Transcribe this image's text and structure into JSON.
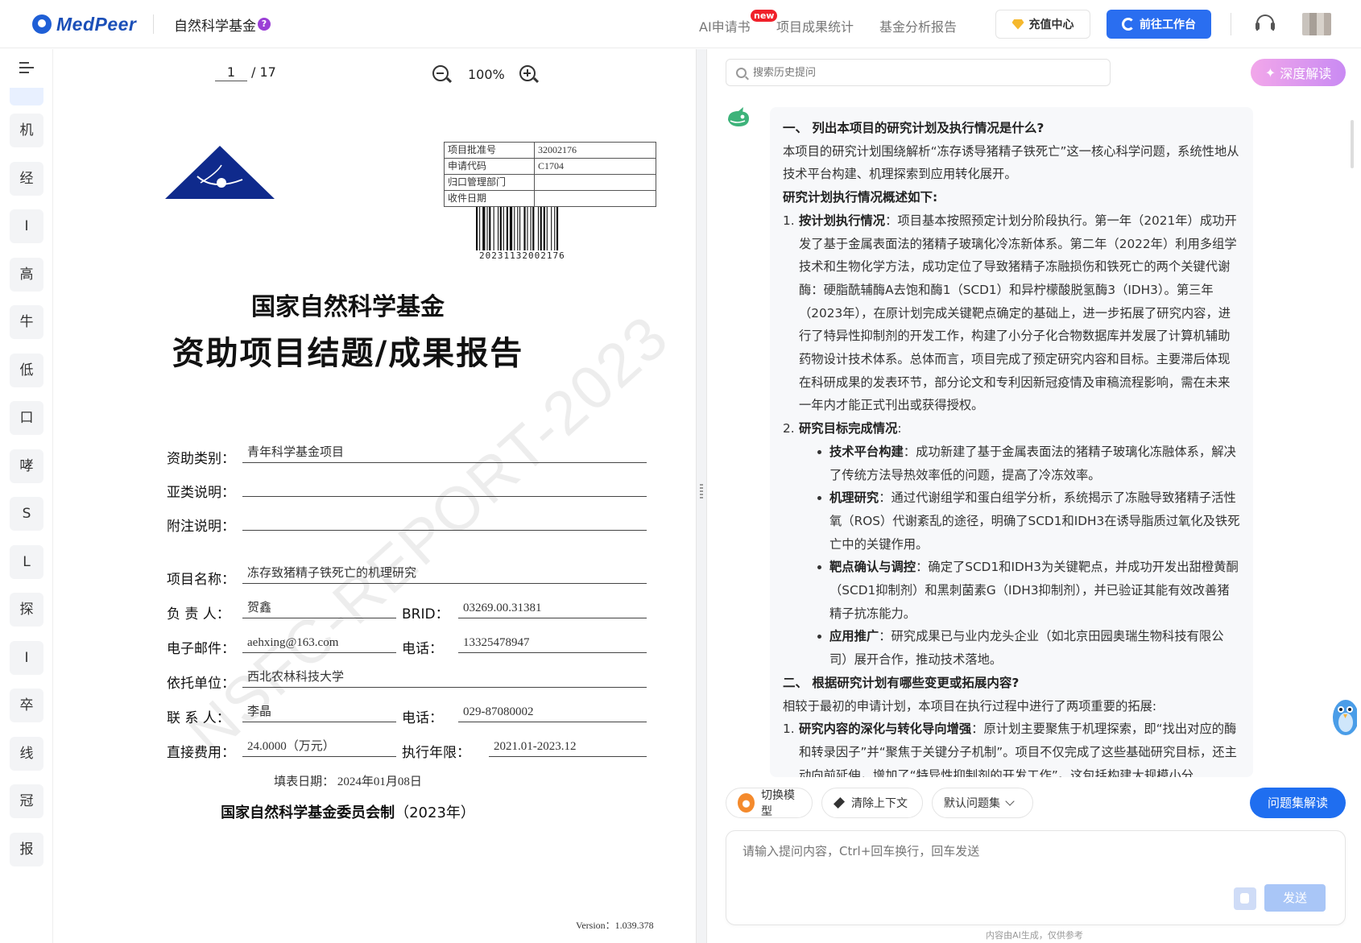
{
  "header": {
    "logo_text": "MedPeer",
    "app_name": "自然科学基金",
    "help_badge": "?",
    "nav": {
      "ai_application": "AI申请书",
      "new_badge": "new",
      "results_stats": "项目成果统计",
      "fund_report": "基金分析报告"
    },
    "recharge_label": "充值中心",
    "workbench_label": "前往工作台"
  },
  "rail": {
    "items": [
      "机",
      "经",
      "I",
      "高",
      "牛",
      "低",
      "口",
      "哮",
      "S",
      "L",
      "探",
      "I",
      "卒",
      "线",
      "冠",
      "报"
    ]
  },
  "viewer": {
    "page": "1",
    "page_total": "/ 17",
    "zoom": "100%"
  },
  "document": {
    "meta": [
      {
        "label": "项目批准号",
        "value": "32002176"
      },
      {
        "label": "申请代码",
        "value": "C1704"
      },
      {
        "label": "归口管理部门",
        "value": ""
      },
      {
        "label": "收件日期",
        "value": ""
      }
    ],
    "barcode_number": "20231132002176",
    "title1": "国家自然科学基金",
    "title2": "资助项目结题/成果报告",
    "fields": {
      "category_label": "资助类别：",
      "category_value": "青年科学基金项目",
      "subcategory_label": "亚类说明：",
      "subcategory_value": "",
      "note_label": "附注说明：",
      "note_value": "",
      "project_label": "项目名称：",
      "project_value": "冻存致猪精子铁死亡的机理研究",
      "leader_label": "负 责 人：",
      "leader_value": "贺鑫",
      "brid_label": "BRID：",
      "brid_value": "03269.00.31381",
      "email_label": "电子邮件：",
      "email_value": "aehxing@163.com",
      "phone_label": "电话：",
      "phone_value": "13325478947",
      "unit_label": "依托单位：",
      "unit_value": "西北农林科技大学",
      "contact_label": "联 系 人：",
      "contact_value": "李晶",
      "contact_phone_label": "电话：",
      "contact_phone_value": "029-87080002",
      "cost_label": "直接费用：",
      "cost_value": "24.0000（万元）",
      "period_label": "执行年限：",
      "period_value": "2021.01-2023.12"
    },
    "fill_date": "填表日期：  2024年01月08日",
    "committee": "国家自然科学基金委员会制",
    "committee_year": "（2023年）",
    "version": "Version：1.039.378",
    "watermark": "NSFC-REPORT-2023"
  },
  "chat": {
    "search_placeholder": "搜索历史提问",
    "deep_label": "深度解读",
    "answer": {
      "q1": "一、 列出本项目的研究计划及执行情况是什么?",
      "q1_intro": "本项目的研究计划围绕解析“冻存诱导猪精子铁死亡”这一核心科学问题，系统性地从技术平台构建、机理探索到应用转化展开。",
      "q1_sub": "研究计划执行情况概述如下:",
      "i1_num": "1.",
      "i1_title": "按计划执行情况",
      "i1_text": "：项目基本按照预定计划分阶段执行。第一年（2021年）成功开发了基于金属表面法的猪精子玻璃化冷冻新体系。第二年（2022年）利用多组学技术和生物化学方法，成功定位了导致猪精子冻融损伤和铁死亡的两个关键代谢酶：硬脂酰辅酶A去饱和酶1（SCD1）和异柠檬酸脱氢酶3（IDH3）。第三年（2023年），在原计划完成关键靶点确定的基础上，进一步拓展了研究内容，进行了特异性抑制剂的开发工作，构建了小分子化合物数据库并发展了计算机辅助药物设计技术体系。总体而言，项目完成了预定研究内容和目标。主要滞后体现在科研成果的发表环节，部分论文和专利因新冠疫情及审稿流程影响，需在未来一年内才能正式刊出或获得授权。",
      "i2_num": "2.",
      "i2_title": "研究目标完成情况",
      "i2_text": ":",
      "b1_title": "技术平台构建",
      "b1_text": "：成功新建了基于金属表面法的猪精子玻璃化冻融体系，解决了传统方法导热效率低的问题，提高了冷冻效率。",
      "b2_title": "机理研究",
      "b2_text": "：通过代谢组学和蛋白组学分析，系统揭示了冻融导致猪精子活性氧（ROS）代谢紊乱的途径，明确了SCD1和IDH3在诱导脂质过氧化及铁死亡中的关键作用。",
      "b3_title": "靶点确认与调控",
      "b3_text": "：确定了SCD1和IDH3为关键靶点，并成功开发出甜橙黄酮（SCD1抑制剂）和黑刺菌素G（IDH3抑制剂），并已验证其能有效改善猪精子抗冻能力。",
      "b4_title": "应用推广",
      "b4_text": "：研究成果已与业内龙头企业（如北京田园奥瑞生物科技有限公司）展开合作，推动技术落地。",
      "q2": "二、 根据研究计划有哪些变更或拓展内容?",
      "q2_intro": "相较于最初的申请计划，本项目在执行过程中进行了两项重要的拓展:",
      "j1_num": "1.",
      "j1_title": "研究内容的深化与转化导向增强",
      "j1_text": "：原计划主要聚焦于机理探索，即“找出对应的酶和转录因子”并“聚焦于关键分子机制”。项目不仅完成了这些基础研究目标，还主动向前延伸，增加了“特异性抑制剂的开发工作”。这包括构建大规模小分"
    },
    "tools": {
      "model": "切换模型",
      "clear": "清除上下文",
      "set": "默认问题集"
    },
    "interpret_label": "问题集解读",
    "prompt_placeholder": "请输入提问内容，Ctrl+回车换行，回车发送",
    "send_label": "发送",
    "ai_note": "内容由AI生成，仅供参考"
  }
}
